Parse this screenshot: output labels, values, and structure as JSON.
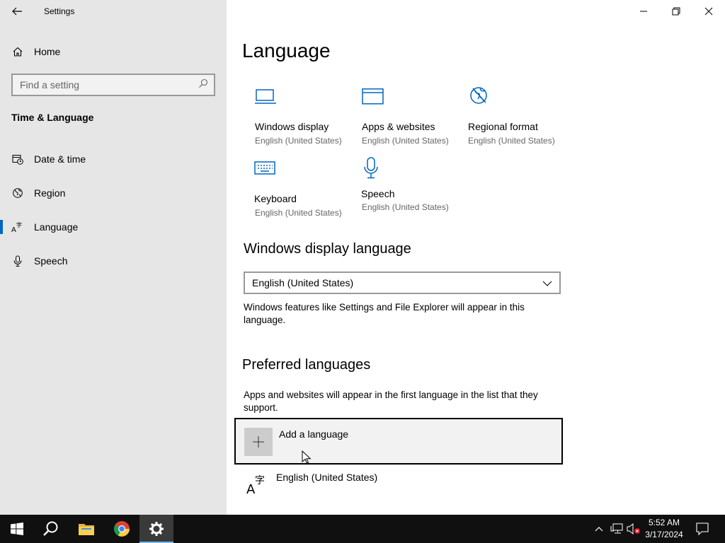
{
  "window": {
    "title": "Settings"
  },
  "sidebar": {
    "home_label": "Home",
    "search_placeholder": "Find a setting",
    "section_title": "Time & Language",
    "items": [
      {
        "label": "Date & time",
        "icon": "calendar-clock-icon"
      },
      {
        "label": "Region",
        "icon": "globe-icon"
      },
      {
        "label": "Language",
        "icon": "language-icon",
        "active": true
      },
      {
        "label": "Speech",
        "icon": "microphone-icon"
      }
    ]
  },
  "main": {
    "title": "Language",
    "tiles": [
      {
        "name": "Windows display",
        "sub": "English (United States)",
        "icon": "monitor-icon"
      },
      {
        "name": "Apps & websites",
        "sub": "English (United States)",
        "icon": "browser-window-icon"
      },
      {
        "name": "Regional format",
        "sub": "English (United States)",
        "icon": "globe-format-icon"
      },
      {
        "name": "Keyboard",
        "sub": "English (United States)",
        "icon": "keyboard-icon"
      },
      {
        "name": "Speech",
        "sub": "English (United States)",
        "icon": "microphone-icon"
      }
    ],
    "display_language": {
      "heading": "Windows display language",
      "selected": "English (United States)",
      "description": "Windows features like Settings and File Explorer will appear in this language."
    },
    "preferred": {
      "heading": "Preferred languages",
      "description": "Apps and websites will appear in the first language in the list that they support.",
      "add_label": "Add a language",
      "languages": [
        "English (United States)"
      ]
    }
  },
  "taskbar": {
    "time": "5:52 AM",
    "date": "3/17/2024"
  },
  "colors": {
    "accent": "#0067c0",
    "sidebar_bg": "#e6e6e6",
    "taskbar_bg": "#101010"
  }
}
